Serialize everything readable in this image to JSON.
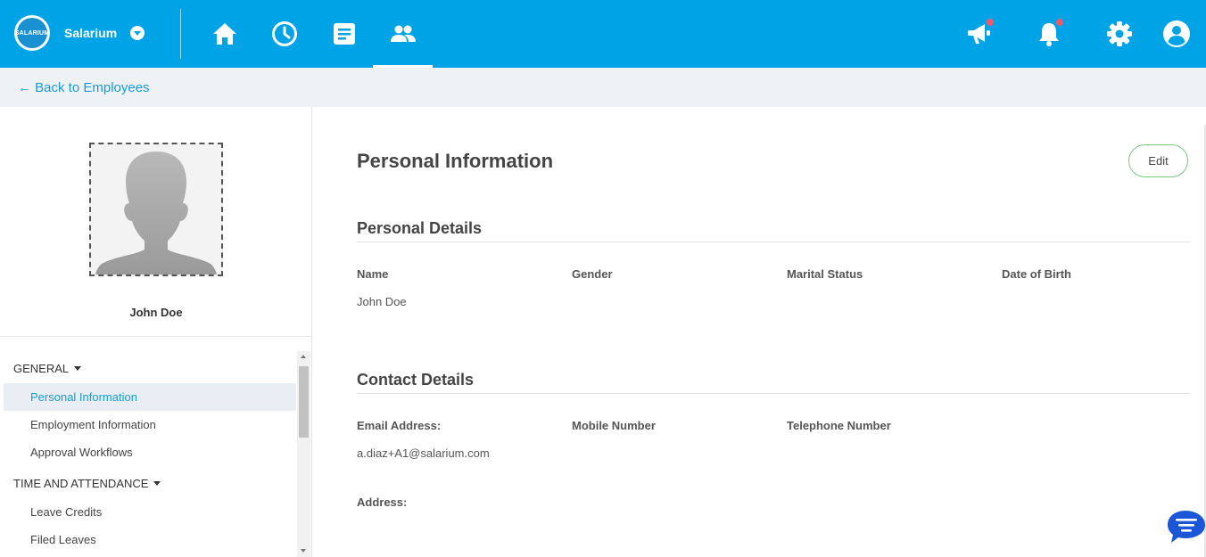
{
  "app": {
    "brand_name": "Salarium",
    "logo_text": "SALARIUM"
  },
  "nav": {
    "items": [
      {
        "icon": "home-icon"
      },
      {
        "icon": "clock-icon"
      },
      {
        "icon": "document-icon"
      },
      {
        "icon": "people-icon",
        "active": true
      }
    ],
    "right_icons": [
      "megaphone-icon",
      "bell-icon",
      "gear-icon",
      "account-icon"
    ]
  },
  "back": {
    "label": "← Back to Employees"
  },
  "profile": {
    "name": "John Doe"
  },
  "sidebar": {
    "groups": [
      {
        "label": "GENERAL",
        "items": [
          "Personal Information",
          "Employment Information",
          "Approval Workflows"
        ]
      },
      {
        "label": "TIME AND ATTENDANCE",
        "items": [
          "Leave Credits",
          "Filed Leaves"
        ]
      }
    ],
    "active_item": "Personal Information"
  },
  "main": {
    "title": "Personal Information",
    "edit_label": "Edit",
    "personal_details": {
      "title": "Personal Details",
      "labels": {
        "name": "Name",
        "gender": "Gender",
        "marital_status": "Marital Status",
        "date_of_birth": "Date of Birth"
      },
      "values": {
        "name": "John Doe"
      }
    },
    "contact_details": {
      "title": "Contact Details",
      "labels": {
        "email": "Email Address:",
        "mobile": "Mobile Number",
        "telephone": "Telephone Number",
        "address": "Address:"
      },
      "values": {
        "email": "a.diaz+A1@salarium.com"
      }
    }
  },
  "colors": {
    "topbar": "#00a3e6",
    "link": "#1a9ad6",
    "edit_border": "#7ac57f",
    "notification_dot": "#ef5a6f",
    "chat_button": "#1a56d6"
  }
}
